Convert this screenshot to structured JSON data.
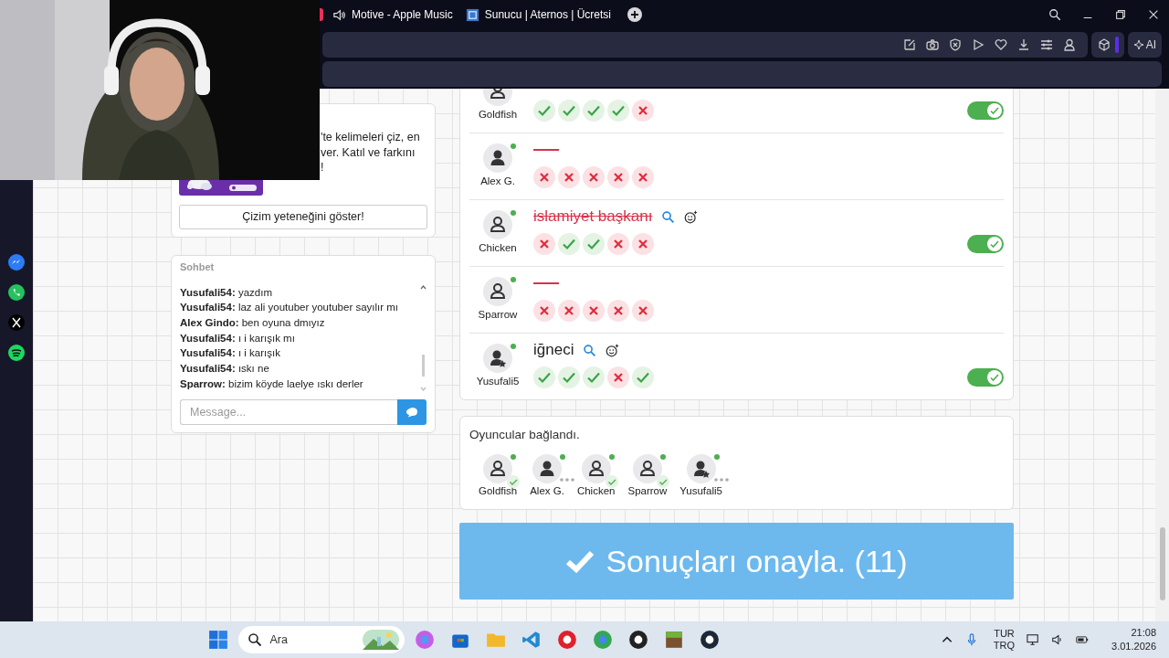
{
  "browser": {
    "tabs": [
      {
        "title": "Motive - Apple Music",
        "kind": "audio"
      },
      {
        "title": "Sunucu | Aternos | Ücretsi",
        "kind": "site"
      }
    ],
    "ai_button": "AI"
  },
  "intro_card": {
    "text_lines": [
      "'te kelimeleri çiz, en",
      "ver. Katıl ve farkını",
      "!"
    ],
    "button": "Çizim yeteneğini göster!"
  },
  "chat": {
    "title": "Sohbet",
    "messages": [
      {
        "author": "Yusufali54:",
        "text": "yazdım"
      },
      {
        "author": "Yusufali54:",
        "text": "laz ali youtuber youtuber sayılır mı"
      },
      {
        "author": "Alex Gindo:",
        "text": "ben oyuna dmıyız"
      },
      {
        "author": "Yusufali54:",
        "text": "ı i karışık mı"
      },
      {
        "author": "Yusufali54:",
        "text": "ı i karışık"
      },
      {
        "author": "Yusufali54:",
        "text": "ıskı ne"
      },
      {
        "author": "Sparrow:",
        "text": "bizim köyde laelye ıskı derler"
      }
    ],
    "placeholder": "Message..."
  },
  "results": [
    {
      "name": "Goldfish",
      "kind": "outline",
      "marks": [
        true,
        true,
        true,
        true,
        false
      ],
      "toggle_on": true
    },
    {
      "name": "Alex G.",
      "kind": "filled",
      "online": true,
      "marks": [
        false,
        false,
        false,
        false,
        false
      ]
    },
    {
      "name": "Chicken",
      "kind": "outline",
      "online": true,
      "word": "islamiyet başkanı",
      "struck": true,
      "marks": [
        false,
        true,
        true,
        false,
        false
      ],
      "toggle_on": true
    },
    {
      "name": "Sparrow",
      "kind": "outline",
      "online": true,
      "marks": [
        false,
        false,
        false,
        false,
        false
      ]
    },
    {
      "name": "Yusufali5",
      "kind": "star",
      "online": true,
      "word": "iğneci",
      "struck": false,
      "marks": [
        true,
        true,
        true,
        false,
        true
      ],
      "toggle_on": true
    }
  ],
  "players_card": {
    "title": "Oyuncular bağlandı.",
    "players": [
      {
        "name": "Goldfish",
        "kind": "outline",
        "online": true,
        "answered": true
      },
      {
        "name": "Alex G.",
        "kind": "filled",
        "online": true,
        "answered": false
      },
      {
        "name": "Chicken",
        "kind": "outline",
        "online": true,
        "answered": true
      },
      {
        "name": "Sparrow",
        "kind": "outline",
        "online": true,
        "answered": true
      },
      {
        "name": "Yusufali5",
        "kind": "star",
        "online": true,
        "answered": false
      }
    ]
  },
  "confirm_button": {
    "label": "Sonuçları onayla. (11)"
  },
  "taskbar": {
    "search_placeholder": "Ara",
    "language": "TUR",
    "layout": "TRQ",
    "time": "21:08",
    "date": "3.01.2026"
  }
}
